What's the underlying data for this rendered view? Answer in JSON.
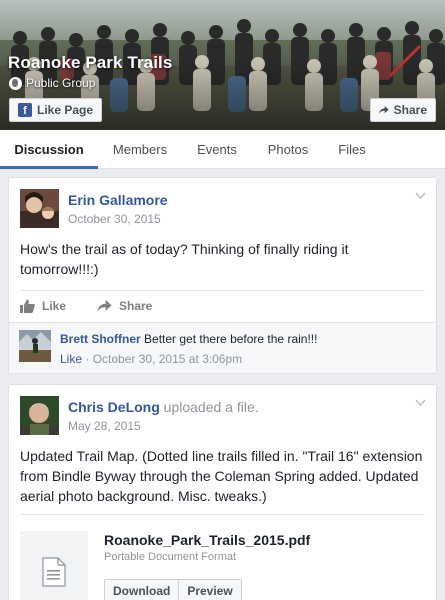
{
  "group": {
    "name": "Roanoke Park Trails",
    "privacy": "Public Group",
    "like_button": "Like Page",
    "share_button": "Share"
  },
  "tabs": [
    "Discussion",
    "Members",
    "Events",
    "Photos",
    "Files"
  ],
  "active_tab": "Discussion",
  "posts": [
    {
      "author": "Erin Gallamore",
      "date": "October 30, 2015",
      "text": "How's the trail as of today? Thinking of finally riding it tomorrow!!!:)",
      "actions": {
        "like": "Like",
        "share": "Share"
      },
      "comment": {
        "author": "Brett Shoffner",
        "text": "Better get there before the rain!!!",
        "like": "Like",
        "timestamp": "October 30, 2015 at 3:06pm"
      }
    },
    {
      "author": "Chris DeLong",
      "activity": "uploaded a file.",
      "date": "May 28, 2015",
      "text": "Updated Trail Map. (Dotted line trails filled in. \"Trail 16\" extension from Bindle Byway through the Coleman Spring added. Updated aerial photo background. Misc. tweaks.)",
      "file": {
        "name": "Roanoke_Park_Trails_2015.pdf",
        "type": "Portable Document Format",
        "download": "Download",
        "preview": "Preview"
      }
    }
  ],
  "colors": {
    "link": "#365899",
    "tab_underline": "#4267b2",
    "background": "#e9ebee"
  },
  "icons": [
    "facebook-f-icon",
    "share-arrow-icon",
    "globe-icon",
    "like-thumb-icon",
    "chevron-down-icon",
    "document-icon"
  ]
}
